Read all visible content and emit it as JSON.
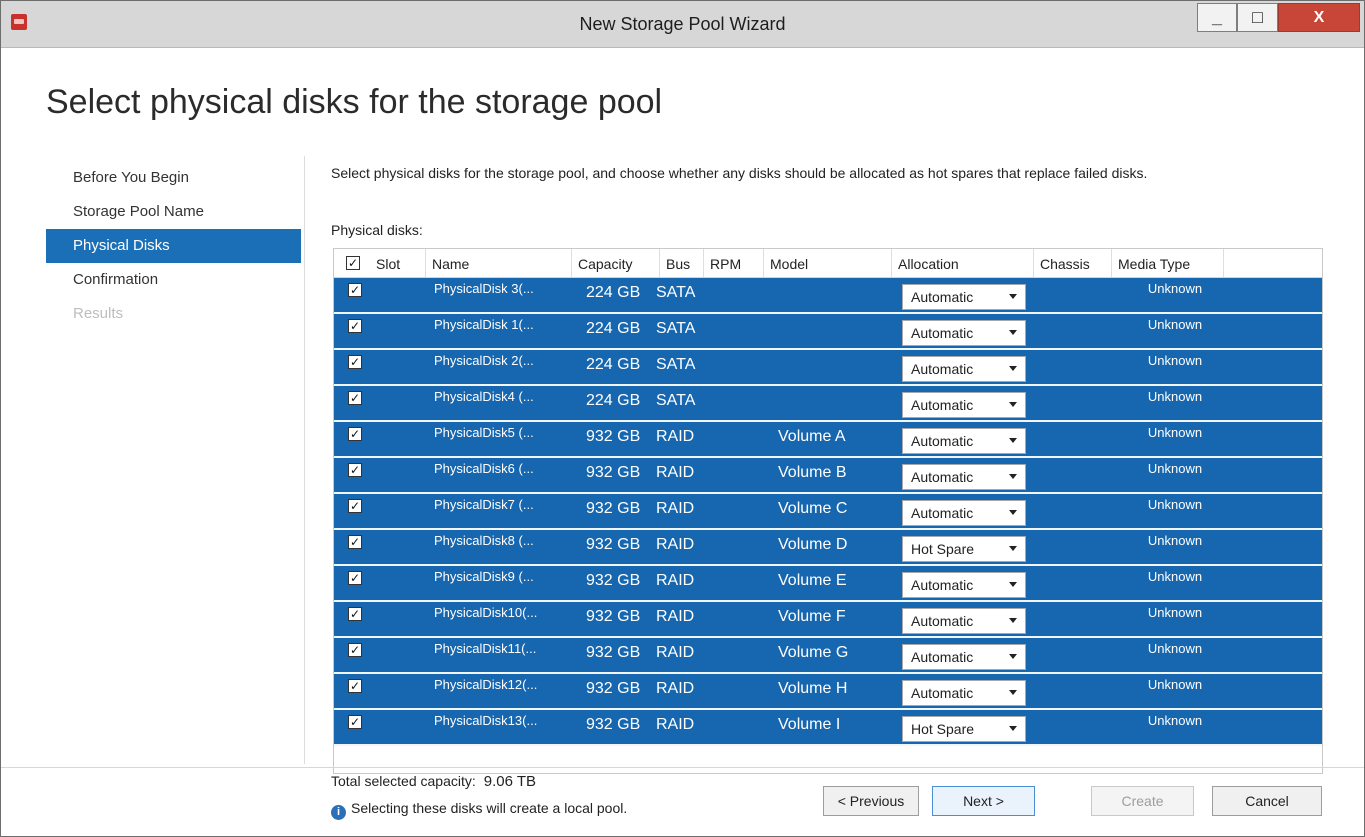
{
  "window": {
    "title": "New Storage Pool Wizard",
    "minimize_label": "_",
    "maximize_label": "□",
    "close_label": "X"
  },
  "page": {
    "heading": "Select physical disks for the storage pool",
    "description": "Select physical disks for the storage pool, and choose whether any disks should be allocated as hot spares that replace failed disks.",
    "disks_label": "Physical disks:"
  },
  "nav": {
    "items": [
      {
        "label": "Before You Begin",
        "state": "normal"
      },
      {
        "label": "Storage Pool Name",
        "state": "normal"
      },
      {
        "label": "Physical Disks",
        "state": "active"
      },
      {
        "label": "Confirmation",
        "state": "normal"
      },
      {
        "label": "Results",
        "state": "disabled"
      }
    ]
  },
  "table": {
    "columns": [
      "Slot",
      "Name",
      "Capacity",
      "Bus",
      "RPM",
      "Model",
      "Allocation",
      "Chassis",
      "Media Type"
    ],
    "header_checked": true,
    "rows": [
      {
        "checked": true,
        "name": "PhysicalDisk 3(...",
        "capacity": "224 GB",
        "bus": "SATA",
        "model": "",
        "allocation": "Automatic",
        "media_type": "Unknown"
      },
      {
        "checked": true,
        "name": "PhysicalDisk 1(...",
        "capacity": "224 GB",
        "bus": "SATA",
        "model": "",
        "allocation": "Automatic",
        "media_type": "Unknown"
      },
      {
        "checked": true,
        "name": "PhysicalDisk 2(...",
        "capacity": "224 GB",
        "bus": "SATA",
        "model": "",
        "allocation": "Automatic",
        "media_type": "Unknown"
      },
      {
        "checked": true,
        "name": "PhysicalDisk4 (...",
        "capacity": "224 GB",
        "bus": "SATA",
        "model": "",
        "allocation": "Automatic",
        "media_type": "Unknown"
      },
      {
        "checked": true,
        "name": "PhysicalDisk5 (...",
        "capacity": "932 GB",
        "bus": "RAID",
        "model": "Volume A",
        "allocation": "Automatic",
        "media_type": "Unknown"
      },
      {
        "checked": true,
        "name": "PhysicalDisk6 (...",
        "capacity": "932 GB",
        "bus": "RAID",
        "model": "Volume B",
        "allocation": "Automatic",
        "media_type": "Unknown"
      },
      {
        "checked": true,
        "name": "PhysicalDisk7 (...",
        "capacity": "932 GB",
        "bus": "RAID",
        "model": "Volume C",
        "allocation": "Automatic",
        "media_type": "Unknown"
      },
      {
        "checked": true,
        "name": "PhysicalDisk8 (...",
        "capacity": "932 GB",
        "bus": "RAID",
        "model": "Volume D",
        "allocation": "Hot Spare",
        "media_type": "Unknown"
      },
      {
        "checked": true,
        "name": "PhysicalDisk9 (...",
        "capacity": "932 GB",
        "bus": "RAID",
        "model": "Volume E",
        "allocation": "Automatic",
        "media_type": "Unknown"
      },
      {
        "checked": true,
        "name": "PhysicalDisk10(...",
        "capacity": "932 GB",
        "bus": "RAID",
        "model": "Volume F",
        "allocation": "Automatic",
        "media_type": "Unknown"
      },
      {
        "checked": true,
        "name": "PhysicalDisk11(...",
        "capacity": "932 GB",
        "bus": "RAID",
        "model": "Volume G",
        "allocation": "Automatic",
        "media_type": "Unknown"
      },
      {
        "checked": true,
        "name": "PhysicalDisk12(...",
        "capacity": "932 GB",
        "bus": "RAID",
        "model": "Volume H",
        "allocation": "Automatic",
        "media_type": "Unknown"
      },
      {
        "checked": true,
        "name": "PhysicalDisk13(...",
        "capacity": "932 GB",
        "bus": "RAID",
        "model": "Volume I",
        "allocation": "Hot Spare",
        "media_type": "Unknown"
      }
    ]
  },
  "footer": {
    "total_label": "Total selected capacity:",
    "total_value": "9.06 TB",
    "info_text": "Selecting these disks will create a local pool.",
    "previous_label": "< Previous",
    "next_label": "Next >",
    "create_label": "Create",
    "cancel_label": "Cancel"
  },
  "colors": {
    "selection_blue": "#1666b0",
    "nav_active": "#1b6fb6"
  }
}
